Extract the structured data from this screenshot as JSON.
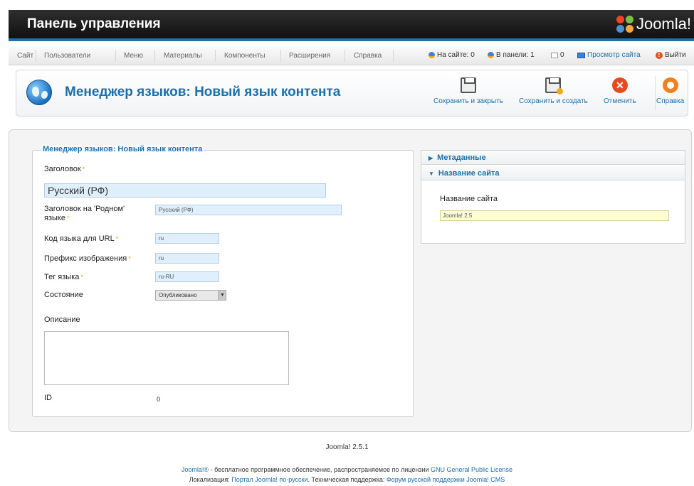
{
  "header": {
    "title": "Панель управления",
    "logo_text": "Joomla!"
  },
  "menu": {
    "items": [
      "Сайт",
      "Пользователи",
      "Меню",
      "Материалы",
      "Компоненты",
      "Расширения",
      "Справка"
    ],
    "status": {
      "online_site": "На сайте: 0",
      "online_admin": "В панели: 1",
      "messages": "0",
      "view_site": "Просмотр сайта",
      "logout": "Выйти"
    }
  },
  "toolbar": {
    "title": "Менеджер языков: Новый язык контента",
    "save_close": "Сохранить и закрыть",
    "save_new": "Сохранить и создать",
    "cancel": "Отменить",
    "help": "Справка"
  },
  "form": {
    "legend": "Менеджер языков: Новый язык контента",
    "title_label": "Заголовок",
    "title_value": "Русский (РФ)",
    "native_label_1": "Заголовок на 'Родном'",
    "native_label_2": "языке",
    "native_value": "Русский (РФ)",
    "code_label": "Код языка для URL",
    "code_value": "ru",
    "image_label": "Префикс изображения",
    "image_value": "ru",
    "tag_label": "Тег языка",
    "tag_value": "ru-RU",
    "state_label": "Состояние",
    "state_value": "Опубликовано",
    "description_label": "Описание",
    "id_label": "ID",
    "id_value": "0",
    "required_mark": "*"
  },
  "sidebar": {
    "metadata": "Метаданные",
    "site_name_section": "Название сайта",
    "site_name_label": "Название сайта",
    "site_name_value": "Joomla! 2.5"
  },
  "footer": {
    "version": "Joomla! 2.5.1",
    "line1_link1": "Joomla!®",
    "line1_text": " - бесплатное программное обеспечение, распространяемое по лицензии ",
    "line1_link2": "GNU General Public License",
    "line2_prefix": "Локализация: ",
    "line2_link1": "Портал Joomla! по-русски",
    "line2_text": ". Техническая поддержка: ",
    "line2_link2": "Форум русской поддержки Joomla! CMS"
  },
  "colors": {
    "accent": "#1d6fa8",
    "header_bg": "#1a1a1a",
    "input_bg": "#e0effc",
    "required": "#f0a020"
  }
}
